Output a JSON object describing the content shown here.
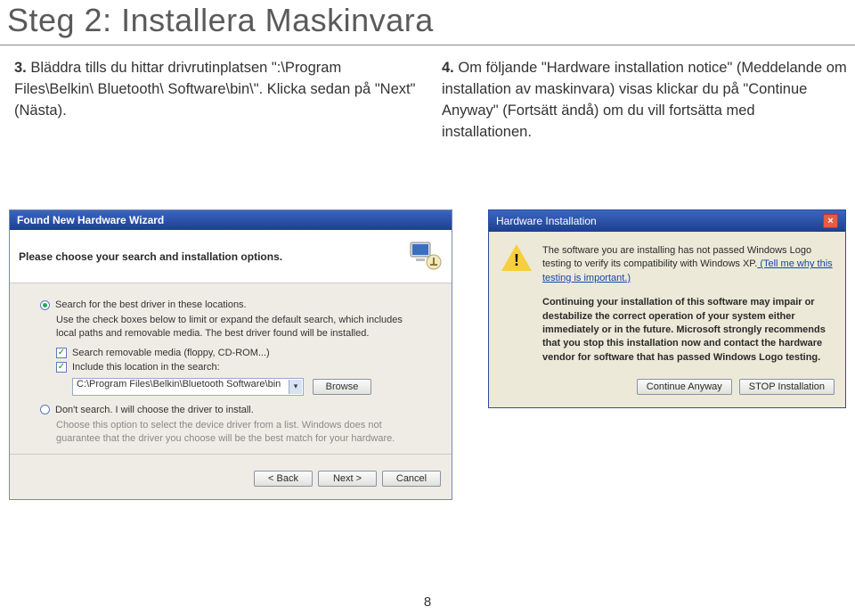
{
  "title": "Steg 2: Installera Maskinvara",
  "left_step": {
    "num": "3.",
    "text": "Bläddra tills du hittar drivrutinplatsen \":\\Program Files\\Belkin\\ Bluetooth\\ Software\\bin\\\". Klicka sedan på \"Next\" (Nästa)."
  },
  "right_step": {
    "num": "4.",
    "text": "Om följande \"Hardware installation notice\" (Meddelande om installation av maskinvara) visas klickar du på \"Continue Anyway\" (Fortsätt ändå) om du vill fortsätta med installationen."
  },
  "wizard": {
    "titlebar": "Found New Hardware Wizard",
    "header": "Please choose your search and installation options.",
    "radio1": "Search for the best driver in these locations.",
    "desc1": "Use the check boxes below to limit or expand the default search, which includes local paths and removable media. The best driver found will be installed.",
    "chk1": "Search removable media (floppy, CD-ROM...)",
    "chk2": "Include this location in the search:",
    "path": "C:\\Program Files\\Belkin\\Bluetooth Software\\bin",
    "browse": "Browse",
    "radio2": "Don't search. I will choose the driver to install.",
    "desc2": "Choose this option to select the device driver from a list. Windows does not guarantee that the driver you choose will be the best match for your hardware.",
    "back": "< Back",
    "next": "Next >",
    "cancel": "Cancel"
  },
  "warn": {
    "titlebar": "Hardware Installation",
    "line1a": "The software you are installing ",
    "line1b": "has not passed Windows Logo testing to verify its compatibility with Windows XP.",
    "link": " (Tell me why this testing is important.)",
    "bold": "Continuing your installation of this software may impair or destabilize the correct operation of your system either immediately or in the future. Microsoft strongly recommends that you stop this installation now and contact the hardware vendor for software that has passed Windows Logo testing.",
    "continue": "Continue Anyway",
    "stop": "STOP Installation"
  },
  "page_number": "8"
}
